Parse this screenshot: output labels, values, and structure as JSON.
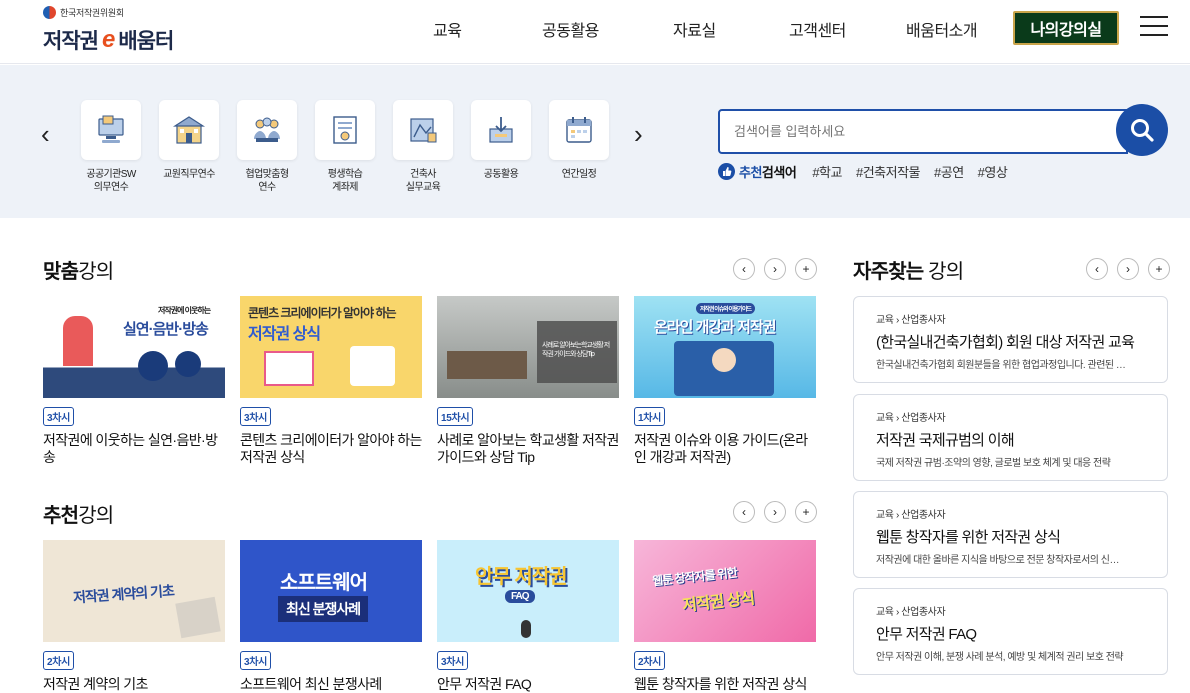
{
  "header": {
    "org_name": "한국저작권위원회",
    "logo_text_a": "저작권",
    "logo_text_e": "e",
    "logo_text_b": "배움터",
    "nav": [
      "교육",
      "공동활용",
      "자료실",
      "고객센터",
      "배움터소개"
    ],
    "my_class": "나의강의실"
  },
  "quick": {
    "items": [
      {
        "label": "공공기관SW\n의무연수",
        "icon": "computer-icon"
      },
      {
        "label": "교원직무연수",
        "icon": "school-icon"
      },
      {
        "label": "협업맞춤형\n연수",
        "icon": "people-icon"
      },
      {
        "label": "평생학습\n계좌제",
        "icon": "certificate-icon"
      },
      {
        "label": "건축사\n실무교육",
        "icon": "blueprint-icon"
      },
      {
        "label": "공동활용",
        "icon": "share-icon"
      },
      {
        "label": "연간일정",
        "icon": "calendar-icon"
      }
    ],
    "prev": "‹",
    "next": "›"
  },
  "search": {
    "placeholder": "검색어를 입력하세요",
    "reco_title_a": "추천",
    "reco_title_b": "검색어",
    "tags": [
      "#학교",
      "#건축저작물",
      "#공연",
      "#영상"
    ]
  },
  "custom": {
    "title_bold": "맞춤",
    "title_rest": "강의",
    "cards": [
      {
        "badge": "3차시",
        "title": "저작권에 이웃하는 실연·음반·방송",
        "thumb_text": "실연·음반·방송",
        "thumb_sub": "저작권에 이웃하는"
      },
      {
        "badge": "3차시",
        "title": "콘텐츠 크리에이터가 알아야 하는 저작권 상식",
        "thumb_text": "저작권 상식",
        "thumb_sub": "콘텐츠 크리에이터가 알아야 하는"
      },
      {
        "badge": "15차시",
        "title": "사례로 알아보는 학교생활 저작권 가이드와 상담 Tip",
        "thumb_text": "사례로 알아보는학교생활 저작권 가이드와 상담Tip"
      },
      {
        "badge": "1차시",
        "title": "저작권 이슈와 이용 가이드(온라인 개강과 저작권)",
        "thumb_text": "온라인 개강과 저작권",
        "thumb_sub": "저작권 이슈와 이용가이드"
      }
    ]
  },
  "recommend": {
    "title_bold": "추천",
    "title_rest": "강의",
    "cards": [
      {
        "badge": "2차시",
        "title": "저작권 계약의 기초",
        "thumb_text": "저작권 계약의 기초"
      },
      {
        "badge": "3차시",
        "title": "소프트웨어 최신 분쟁사례",
        "thumb_text": "소프트웨어",
        "thumb_sub": "최신 분쟁사례"
      },
      {
        "badge": "3차시",
        "title": "안무 저작권 FAQ",
        "thumb_text": "안무 저작권",
        "thumb_sub": "FAQ"
      },
      {
        "badge": "2차시",
        "title": "웹툰 창작자를 위한 저작권 상식",
        "thumb_text": "저작권 상식",
        "thumb_sub": "웹툰 창작자를 위한"
      }
    ]
  },
  "frequent": {
    "title_bold": "자주찾는",
    "title_rest": " 강의",
    "items": [
      {
        "crumb": "교육 › 산업종사자",
        "title": "(한국실내건축가협회) 회원 대상 저작권 교육",
        "desc": "한국실내건축가협회 회원분들을 위한 협업과정입니다. 관련된 …"
      },
      {
        "crumb": "교육 › 산업종사자",
        "title": "저작권 국제규범의 이해",
        "desc": "국제 저작권 규범·조약의 영향, 글로벌 보호 체계 및 대응 전략"
      },
      {
        "crumb": "교육 › 산업종사자",
        "title": "웹툰 창작자를 위한 저작권 상식",
        "desc": "저작권에 대한 올바른 지식을 바탕으로 전문 창작자로서의 신…"
      },
      {
        "crumb": "교육 › 산업종사자",
        "title": "안무 저작권 FAQ",
        "desc": "안무 저작권 이해, 분쟁 사례 분석, 예방 및 체계적 권리 보호 전략"
      }
    ]
  },
  "controls": {
    "prev": "‹",
    "next": "›",
    "more": "+"
  },
  "colors": {
    "brand_blue": "#1b4ea6",
    "my_class_bg": "#0a3a1a",
    "quickbar_bg": "#eef2f8"
  }
}
